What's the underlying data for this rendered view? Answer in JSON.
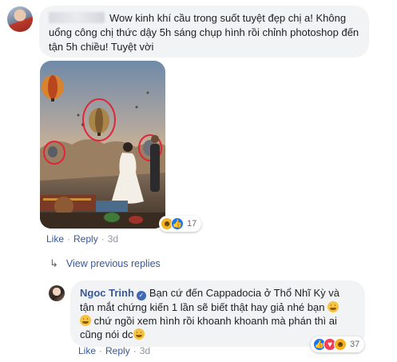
{
  "main_comment": {
    "text": "Wow kinh khí cầu trong suốt tuyệt đẹp chị a! Không uổng công chị thức dậy 5h sáng chụp hình rồi chỉnh photoshop đến tận 5h chiều! Tuyệt vời",
    "reaction_count": "17",
    "like_label": "Like",
    "reply_label": "Reply",
    "separator": "·",
    "time": "3d",
    "reaction_icons": [
      "haha-icon",
      "like-icon"
    ]
  },
  "view_previous": {
    "label": "View previous replies"
  },
  "reply": {
    "author": "Ngoc Trinh",
    "text_part1": "Bạn cứ đến Cappadocia ở Thổ Nhĩ Kỳ và tận mắt chứng kiến 1 lần sẽ biết thật hay giả nhé bạn ",
    "text_part2": " chứ ngồi xem hình rồi khoanh khoanh mà phán thì ai cũng nói dc",
    "reaction_count": "37",
    "like_label": "Like",
    "reply_label": "Reply",
    "separator": "·",
    "time": "3d",
    "reaction_icons": [
      "like-icon",
      "love-icon",
      "haha-icon"
    ]
  },
  "colors": {
    "link": "#385898",
    "bubble_bg": "#f2f3f5",
    "meta_gray": "#90949c",
    "annotation_red": "#e0253a"
  }
}
